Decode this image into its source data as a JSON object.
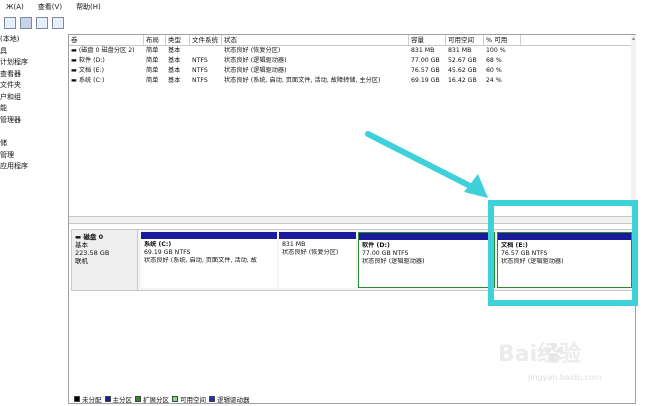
{
  "menu": {
    "items": [
      "Ж(A)",
      "查看(V)",
      "帮助(H)"
    ]
  },
  "sidebar": {
    "items": [
      "(本地)",
      "具",
      "计划程序",
      "查看器",
      "文件夹",
      "户和组",
      "能",
      "管理器",
      "",
      "储",
      "管理",
      "应用程序"
    ]
  },
  "volume_table": {
    "headers": [
      "卷",
      "布局",
      "类型",
      "文件系统",
      "状态",
      "容量",
      "可用空间",
      "% 可用"
    ],
    "rows": [
      [
        "(磁盘 0 磁盘分区 2)",
        "简单",
        "基本",
        "",
        "状态良好 (恢复分区)",
        "831 MB",
        "831 MB",
        "100 %"
      ],
      [
        "软件 (D:)",
        "简单",
        "基本",
        "NTFS",
        "状态良好 (逻辑驱动器)",
        "77.00 GB",
        "52.67 GB",
        "68 %"
      ],
      [
        "文档 (E:)",
        "简单",
        "基本",
        "NTFS",
        "状态良好 (逻辑驱动器)",
        "76.57 GB",
        "45.62 GB",
        "60 %"
      ],
      [
        "系统 (C:)",
        "简单",
        "基本",
        "NTFS",
        "状态良好 (系统, 启动, 页面文件, 活动, 故障转储, 主分区)",
        "69.19 GB",
        "16.42 GB",
        "24 %"
      ]
    ]
  },
  "disk": {
    "name": "磁盘 0",
    "type": "基本",
    "size": "223.58 GB",
    "status": "联机"
  },
  "partitions": [
    {
      "name": "系统 (C:)",
      "size": "69.19 GB NTFS",
      "status": "状态良好 (系统, 启动, 页面文件, 活动, 故"
    },
    {
      "name": "",
      "size": "831 MB",
      "status": "状态良好 (恢复分区)"
    },
    {
      "name": "软件 (D:)",
      "size": "77.00 GB NTFS",
      "status": "状态良好 (逻辑驱动器)"
    },
    {
      "name": "文档 (E:)",
      "size": "76.57 GB NTFS",
      "status": "状态良好 (逻辑驱动器)"
    }
  ],
  "legend": [
    "未分配",
    "主分区",
    "扩展分区",
    "可用空间",
    "逻辑驱动器"
  ],
  "legend_colors": [
    "#000000",
    "#1a1a9a",
    "#2f8a2f",
    "#7ee07e",
    "#2a2ab8"
  ],
  "watermark": {
    "text": "Bai经验",
    "sub": "jingyan.baidu.com"
  },
  "colors": {
    "highlight": "#3fd1d9",
    "partition_bar": "#1a1a9a",
    "selected": "#2f8a2f"
  }
}
